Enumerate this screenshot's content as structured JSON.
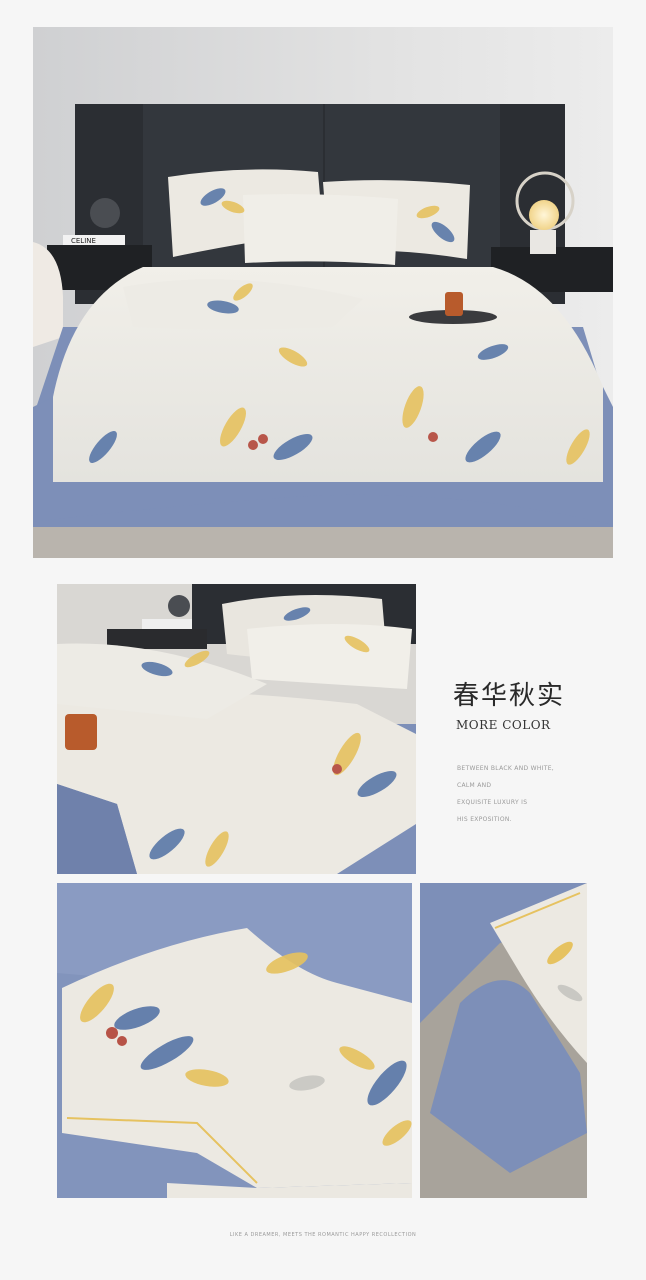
{
  "images": {
    "hero": "bedroom-bed-with-floral-bedding",
    "detail1": "bedding-corner-closeup",
    "detail2": "pillow-closeup",
    "detail3": "sheet-corner-closeup"
  },
  "colors": {
    "background": "#f6f6f6",
    "fabric_blue": "#7d8fb8",
    "fabric_cream": "#ece9e2",
    "headboard": "#2b2e33",
    "leaf_yellow": "#e6c260",
    "leaf_blue": "#5a78a8"
  },
  "headline": "春华秋实",
  "subhead": "MORE COLOR",
  "description": [
    "BETWEEN BLACK AND WHITE,",
    "CALM AND",
    "EXQUISITE LUXURY IS",
    "HIS EXPOSITION."
  ],
  "hero_props": {
    "book_label": "CELINE"
  },
  "footer": "LIKE A DREAMER, MEETS THE ROMANTIC HAPPY RECOLLECTION"
}
